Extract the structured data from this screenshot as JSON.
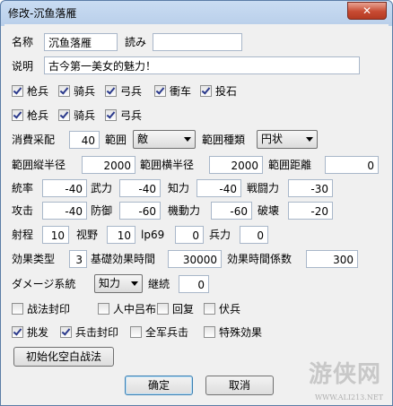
{
  "window": {
    "title": "修改-沉鱼落雁",
    "close_label": "✕"
  },
  "name": {
    "label": "名称",
    "value": "沉鱼落雁",
    "reading_label": "読み",
    "reading_value": ""
  },
  "desc": {
    "label": "说明",
    "value": "古今第一美女的魅力！"
  },
  "troops_row1": [
    {
      "label": "枪兵",
      "checked": true
    },
    {
      "label": "骑兵",
      "checked": true
    },
    {
      "label": "弓兵",
      "checked": true
    },
    {
      "label": "衝车",
      "checked": true
    },
    {
      "label": "投石",
      "checked": true
    }
  ],
  "troops_row2": [
    {
      "label": "枪兵",
      "checked": true
    },
    {
      "label": "骑兵",
      "checked": true
    },
    {
      "label": "弓兵",
      "checked": true
    }
  ],
  "cost": {
    "label": "消費采配",
    "value": "40",
    "range_label": "範囲",
    "range_value": "敵",
    "range_type_label": "範囲種類",
    "range_type_value": "円状"
  },
  "radius": {
    "v_label": "範囲縦半径",
    "v_value": "2000",
    "h_label": "範囲横半径",
    "h_value": "2000",
    "dist_label": "範囲距離",
    "dist_value": "0"
  },
  "stats_row1": [
    {
      "label": "統率",
      "value": "-40"
    },
    {
      "label": "武力",
      "value": "-40"
    },
    {
      "label": "知力",
      "value": "-40"
    },
    {
      "label": "戦闘力",
      "value": "-30"
    }
  ],
  "stats_row2": [
    {
      "label": "攻击",
      "value": "-40"
    },
    {
      "label": "防御",
      "value": "-60"
    },
    {
      "label": "機動力",
      "value": "-60"
    },
    {
      "label": "破壊",
      "value": "-20"
    }
  ],
  "stats_row3": [
    {
      "label": "射程",
      "value": "10"
    },
    {
      "label": "视野",
      "value": "10"
    },
    {
      "label": "lp69",
      "value": "0"
    },
    {
      "label": "兵力",
      "value": "0"
    }
  ],
  "effect": {
    "type_label": "効果类型",
    "type_value": "3",
    "base_label": "基礎効果時間",
    "base_value": "30000",
    "coef_label": "効果時間係数",
    "coef_value": "300"
  },
  "damage": {
    "label": "ダメージ系統",
    "value": "知力",
    "cont_label": "継続",
    "cont_value": "0"
  },
  "flags_row1": [
    {
      "label": "战法封印",
      "checked": false
    },
    {
      "label": "人中吕布",
      "checked": false
    },
    {
      "label": "回复",
      "checked": false
    },
    {
      "label": "伏兵",
      "checked": false
    }
  ],
  "flags_row2": [
    {
      "label": "挑发",
      "checked": true
    },
    {
      "label": "兵击封印",
      "checked": true
    },
    {
      "label": "全军兵击",
      "checked": false
    },
    {
      "label": "特殊効果",
      "checked": false
    }
  ],
  "buttons": {
    "init": "初始化空白战法",
    "ok": "确定",
    "cancel": "取消"
  },
  "watermark": {
    "main": "游侠网",
    "sub": "WWW.ALI213.NET"
  }
}
